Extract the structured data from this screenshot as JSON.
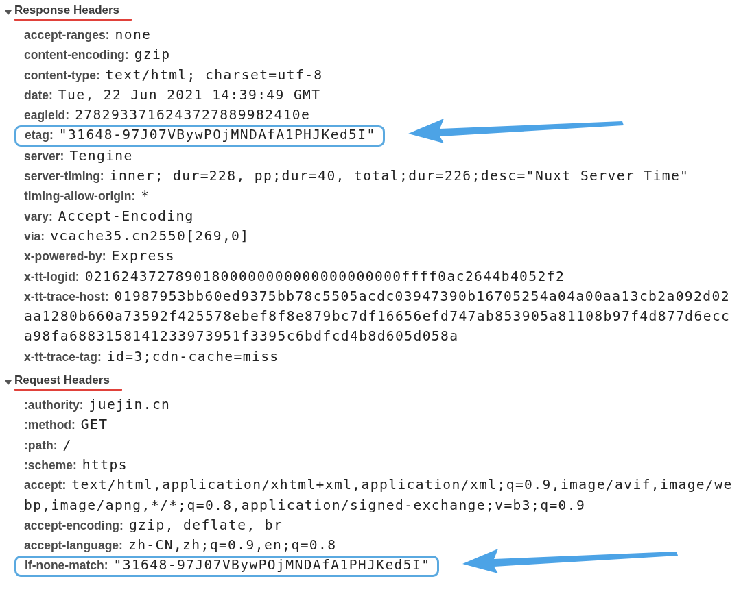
{
  "sections": [
    {
      "title": "Response Headers",
      "expanded": true,
      "underlined": true,
      "headers": [
        {
          "name": "accept-ranges:",
          "value": "none",
          "highlighted": false
        },
        {
          "name": "content-encoding:",
          "value": "gzip",
          "highlighted": false
        },
        {
          "name": "content-type:",
          "value": "text/html; charset=utf-8",
          "highlighted": false
        },
        {
          "name": "date:",
          "value": "Tue, 22 Jun 2021 14:39:49 GMT",
          "highlighted": false
        },
        {
          "name": "eagleid:",
          "value": "2782933716243727889982410e",
          "highlighted": false
        },
        {
          "name": "etag:",
          "value": "\"31648-97J07VBywPOjMNDAfA1PHJKed5I\"",
          "highlighted": true
        },
        {
          "name": "server:",
          "value": "Tengine",
          "highlighted": false
        },
        {
          "name": "server-timing:",
          "value": "inner; dur=228, pp;dur=40, total;dur=226;desc=\"Nuxt Server Time\"",
          "highlighted": false
        },
        {
          "name": "timing-allow-origin:",
          "value": "*",
          "highlighted": false
        },
        {
          "name": "vary:",
          "value": "Accept-Encoding",
          "highlighted": false
        },
        {
          "name": "via:",
          "value": "vcache35.cn2550[269,0]",
          "highlighted": false
        },
        {
          "name": "x-powered-by:",
          "value": "Express",
          "highlighted": false
        },
        {
          "name": "x-tt-logid:",
          "value": "02162437278901800000000000000000000ffff0ac2644b4052f2",
          "highlighted": false
        },
        {
          "name": "x-tt-trace-host:",
          "value": "01987953bb60ed9375bb78c5505acdc03947390b16705254a04a00aa13cb2a092d02aa1280b660a73592f425578ebef8f8e879bc7df16656efd747ab853905a81108b97f4d877d6ecca98fa6883158141233973951f3395c6bdfcd4b8d605d058a",
          "highlighted": false
        },
        {
          "name": "x-tt-trace-tag:",
          "value": "id=3;cdn-cache=miss",
          "highlighted": false
        }
      ]
    },
    {
      "title": "Request Headers",
      "expanded": true,
      "underlined": true,
      "headers": [
        {
          "name": ":authority:",
          "value": "juejin.cn",
          "highlighted": false
        },
        {
          "name": ":method:",
          "value": "GET",
          "highlighted": false
        },
        {
          "name": ":path:",
          "value": "/",
          "highlighted": false
        },
        {
          "name": ":scheme:",
          "value": "https",
          "highlighted": false
        },
        {
          "name": "accept:",
          "value": "text/html,application/xhtml+xml,application/xml;q=0.9,image/avif,image/webp,image/apng,*/*;q=0.8,application/signed-exchange;v=b3;q=0.9",
          "highlighted": false
        },
        {
          "name": "accept-encoding:",
          "value": "gzip, deflate, br",
          "highlighted": false
        },
        {
          "name": "accept-language:",
          "value": "zh-CN,zh;q=0.9,en;q=0.8",
          "highlighted": false
        },
        {
          "name": "if-none-match:",
          "value": "\"31648-97J07VBywPOjMNDAfA1PHJKed5I\"",
          "highlighted": true
        }
      ]
    }
  ]
}
